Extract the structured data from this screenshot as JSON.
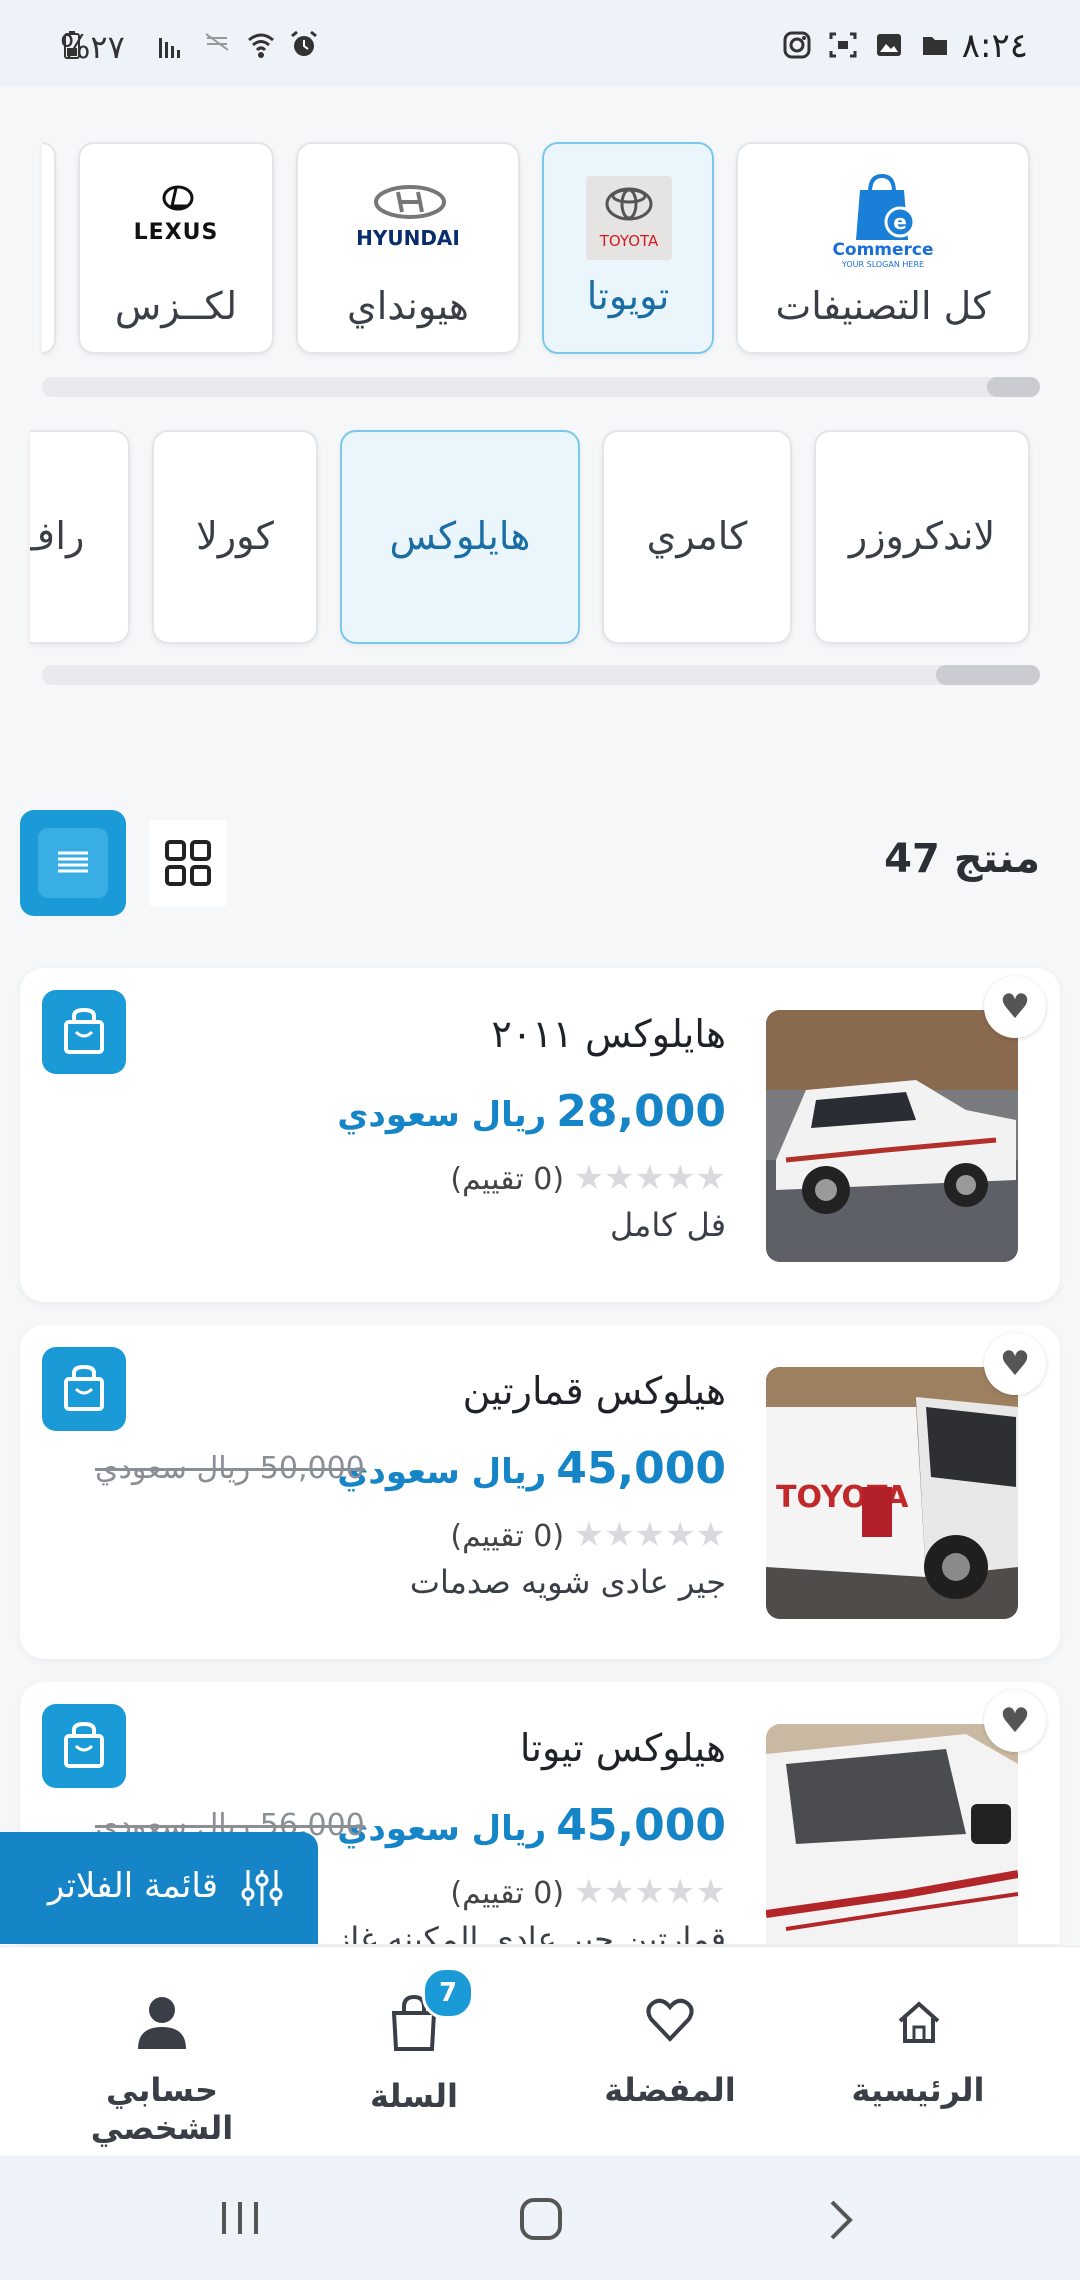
{
  "status_bar": {
    "time": "٨:٢٤",
    "battery": "%٢٧"
  },
  "brands": {
    "items": [
      {
        "label": "كل التصنيفات",
        "logo_text": "Commerce",
        "logo_sub": "YOUR SLOGAN HERE",
        "active": false
      },
      {
        "label": "تويوتا",
        "logo_text": "TOYOTA",
        "active": true
      },
      {
        "label": "هيونداي",
        "logo_text": "HYUNDAI",
        "active": false
      },
      {
        "label": "لكــزس",
        "logo_text": "LEXUS",
        "active": false
      }
    ]
  },
  "models": {
    "items": [
      {
        "label": "لاندكروزر",
        "active": false
      },
      {
        "label": "كامري",
        "active": false
      },
      {
        "label": "هايلوكس",
        "active": true
      },
      {
        "label": "كورلا",
        "active": false
      },
      {
        "label": "راف",
        "active": false
      }
    ]
  },
  "results": {
    "count_label": "47 منتج"
  },
  "products": [
    {
      "title": "هايلوكس ٢٠١١",
      "price": "28,000",
      "currency": "ريال سعودي",
      "old_price": "",
      "rating": "(0 تقييم)",
      "description": "فل كامل"
    },
    {
      "title": "هيلوكس قمارتين",
      "price": "45,000",
      "currency": "ريال سعودي",
      "old_price": "50,000 ريال سعودي",
      "rating": "(0 تقييم)",
      "description": "جير عادى شويه صدمات"
    },
    {
      "title": "هيلوكس تيوتا",
      "price": "45,000",
      "currency": "ريال سعودي",
      "old_price": "56,000 ريال سعودي",
      "rating": "(0 تقييم)",
      "description": "قمارتين جير عادى المكينه غاز"
    }
  ],
  "filter": {
    "label": "قائمة الفلاتر"
  },
  "bottom_nav": {
    "home": "الرئيسية",
    "favorites": "المفضلة",
    "cart": "السلة",
    "cart_badge": "7",
    "account": "حسابي الشخصي"
  },
  "colors": {
    "accent": "#1a9ad6",
    "price": "#1585c7",
    "active_bg": "#eaf6fc",
    "active_border": "#7cc8ea"
  }
}
